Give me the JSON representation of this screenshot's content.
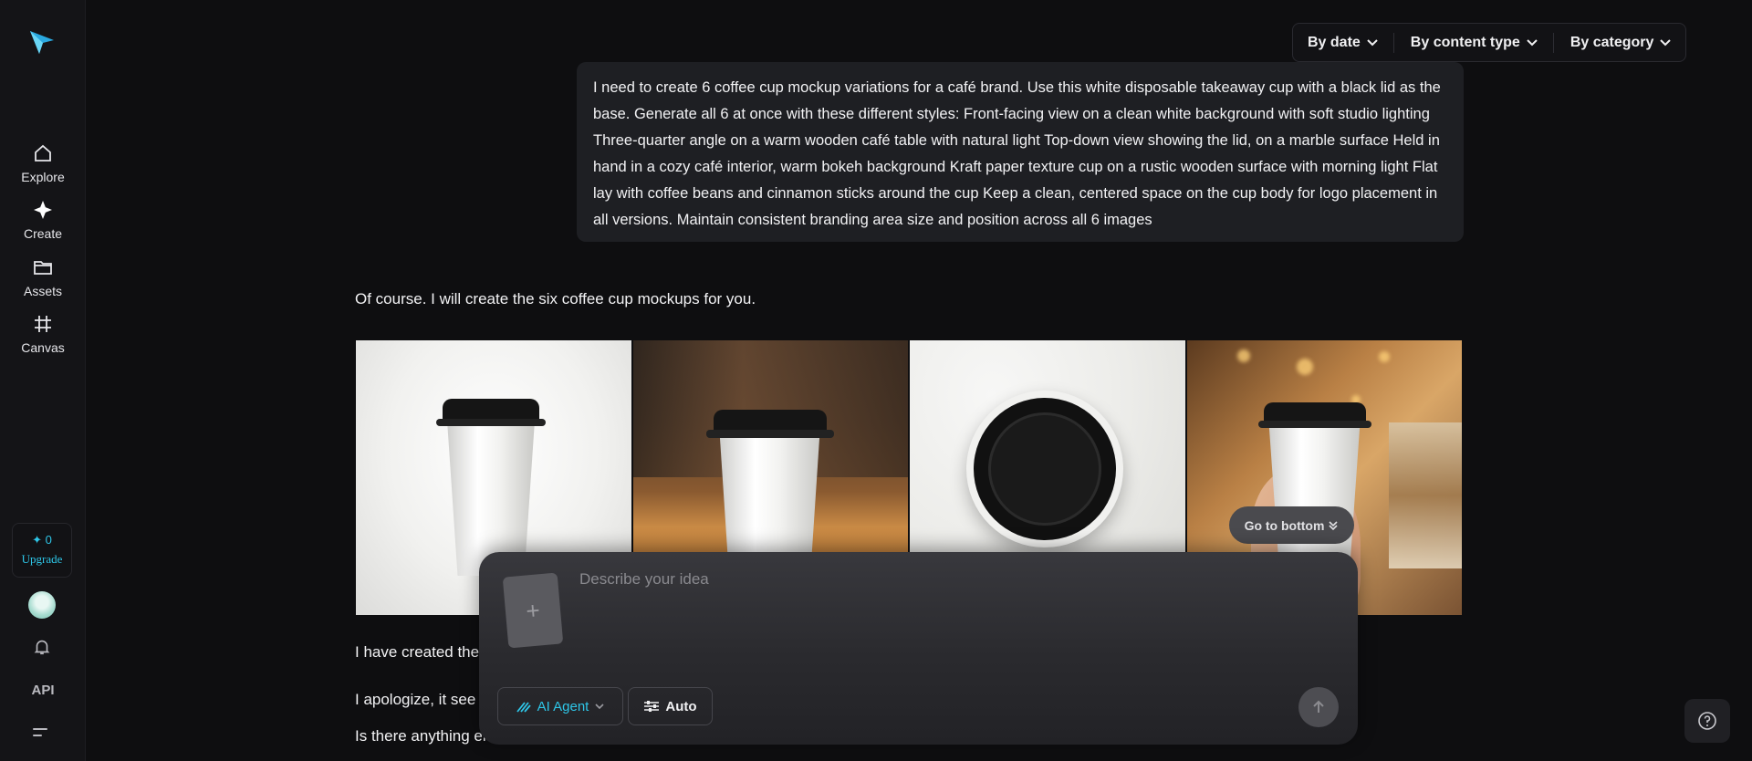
{
  "sidebar": {
    "items": [
      {
        "label": "Explore",
        "icon": "home-icon"
      },
      {
        "label": "Create",
        "icon": "sparkle-icon"
      },
      {
        "label": "Assets",
        "icon": "folder-icon"
      },
      {
        "label": "Canvas",
        "icon": "frame-icon"
      }
    ],
    "credits": "✦ 0",
    "upgrade_label": "Upgrade",
    "api_label": "API"
  },
  "filters": {
    "date": "By date",
    "content_type": "By content type",
    "category": "By category"
  },
  "conversation": {
    "prompt": "I need to create 6 coffee cup mockup variations for a café brand. Use this white disposable takeaway cup with a black lid as the base. Generate all 6 at once with these different styles: Front-facing view on a clean white background with soft studio lighting Three-quarter angle on a warm wooden café table with natural light Top-down view showing the lid, on a marble surface Held in hand in a cozy café interior, warm bokeh background Kraft paper texture cup on a rustic wooden surface with morning light Flat lay with coffee beans and cinnamon sticks around the cup Keep a clean, centered space on the cup body for logo placement in all versions. Maintain consistent branding area size and position across all 6 images",
    "reply": "Of course. I will create the six coffee cup mockups for you.",
    "followup_1": "I have created the",
    "followup_2": "I apologize, it see",
    "followup_3": "Is there anything el"
  },
  "go_to_bottom": "Go to bottom",
  "composer": {
    "placeholder": "Describe your idea",
    "agent_label": "AI Agent",
    "auto_label": "Auto"
  },
  "colors": {
    "accent": "#2ec6e8",
    "background": "#0e0e10"
  }
}
